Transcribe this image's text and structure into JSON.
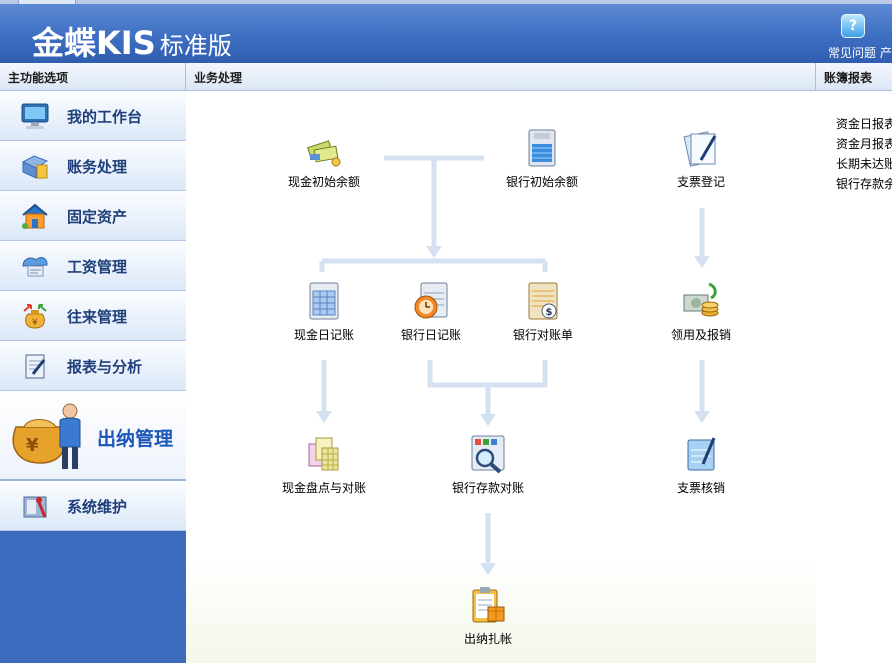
{
  "header": {
    "brand": "金蝶KIS",
    "edition": "标准版",
    "faq_label": "常见问题  产"
  },
  "sections": {
    "left": "主功能选项",
    "middle": "业务处理",
    "right": "账簿报表"
  },
  "sidebar": {
    "items": [
      {
        "label": "我的工作台",
        "icon": "monitor-icon"
      },
      {
        "label": "账务处理",
        "icon": "ledger-icon"
      },
      {
        "label": "固定资产",
        "icon": "house-icon"
      },
      {
        "label": "工资管理",
        "icon": "salary-icon"
      },
      {
        "label": "往来管理",
        "icon": "money-bag-arrows-icon"
      },
      {
        "label": "报表与分析",
        "icon": "report-icon"
      },
      {
        "label": "出纳管理",
        "icon": "cashier-bag-icon",
        "active": true
      },
      {
        "label": "系统维护",
        "icon": "tools-icon"
      }
    ]
  },
  "flow": {
    "nodes": [
      {
        "id": "cash-initial",
        "label": "现金初始余额",
        "icon": "cash-bills-icon"
      },
      {
        "id": "bank-initial",
        "label": "银行初始余额",
        "icon": "bank-book-icon"
      },
      {
        "id": "check-register",
        "label": "支票登记",
        "icon": "check-pen-icon"
      },
      {
        "id": "cash-journal",
        "label": "现金日记账",
        "icon": "calendar-book-icon"
      },
      {
        "id": "bank-journal",
        "label": "银行日记账",
        "icon": "clock-calendar-icon"
      },
      {
        "id": "bank-statement",
        "label": "银行对账单",
        "icon": "dollar-sheet-icon"
      },
      {
        "id": "check-use",
        "label": "领用及报销",
        "icon": "coins-check-icon"
      },
      {
        "id": "cash-count",
        "label": "现金盘点与对账",
        "icon": "stacked-sheets-icon"
      },
      {
        "id": "bank-reconcile",
        "label": "银行存款对账",
        "icon": "magnifier-chart-icon"
      },
      {
        "id": "check-verify",
        "label": "支票核销",
        "icon": "check-verify-icon"
      },
      {
        "id": "cashier-close",
        "label": "出纳扎帐",
        "icon": "clipboard-box-icon"
      }
    ]
  },
  "reports": {
    "links": [
      "资金日报表",
      "资金月报表",
      "长期未达账",
      "银行存款余"
    ]
  },
  "colors": {
    "header_blue": "#3f6fc3",
    "nav_blue": "#3d6bbd",
    "flow_arrow": "#d3e1f1",
    "active_label": "#1b56b8"
  }
}
